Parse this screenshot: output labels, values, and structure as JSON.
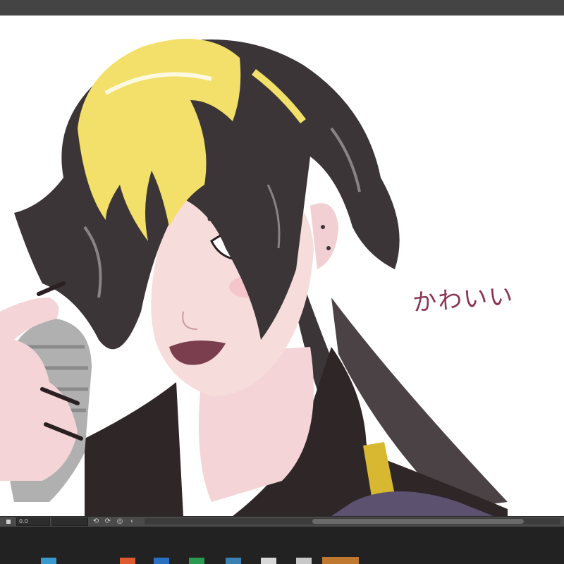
{
  "status_bar": {
    "zoom_value": "0.0",
    "field_value": "",
    "buttons": [
      "rotate-left-icon",
      "rotate-right-icon",
      "reset-view-icon",
      "collapse-icon"
    ]
  },
  "handwriting_text": "かわいい",
  "colors": {
    "canvas": "#ffffff",
    "chrome": "#444444",
    "taskbar": "#222222",
    "hair_dark": "#3b3537",
    "hair_blonde": "#f2e06a",
    "skin": "#f7dcdc",
    "lips": "#7a3e4e",
    "eye": "#a9d4ee",
    "jacket": "#2f2628",
    "trim": "#d8b830",
    "handwriting": "#8a3555"
  }
}
